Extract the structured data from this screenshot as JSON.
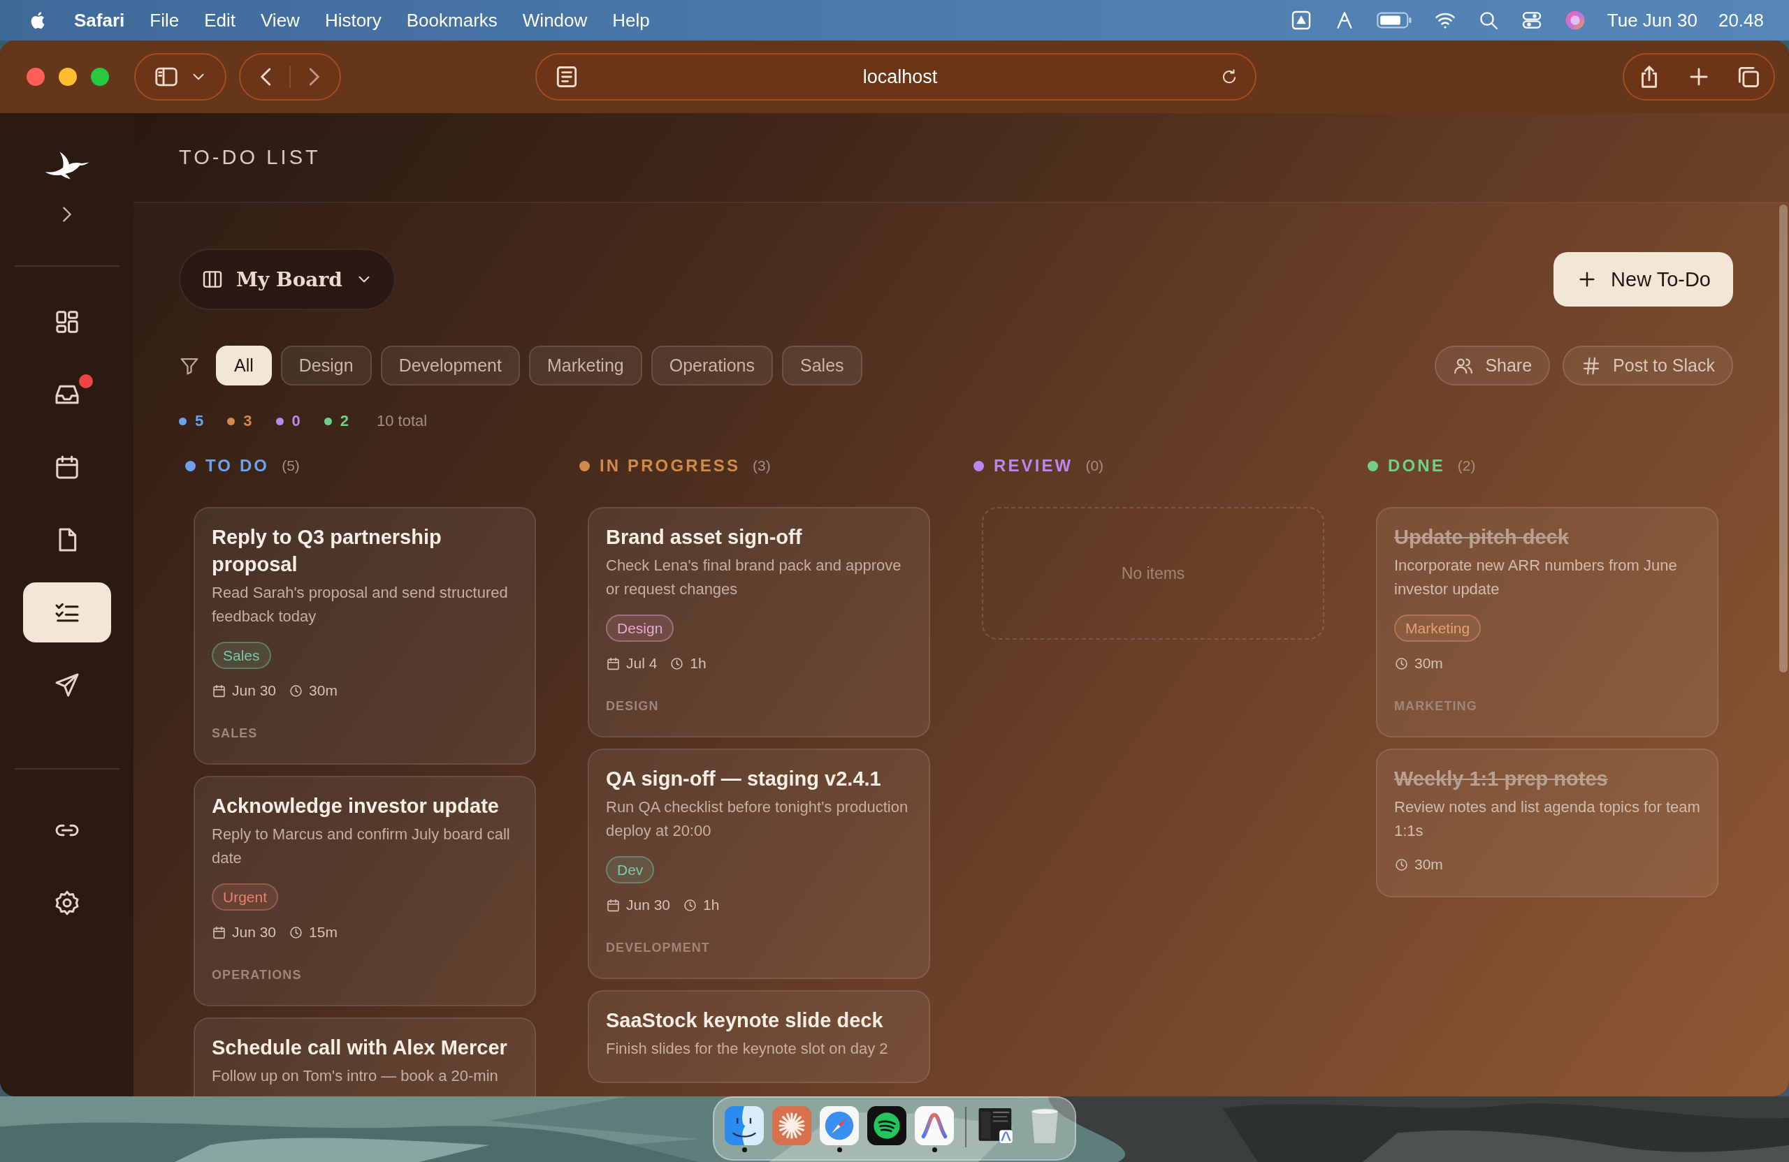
{
  "menu_bar": {
    "app": "Safari",
    "menus": [
      "File",
      "Edit",
      "View",
      "History",
      "Bookmarks",
      "Window",
      "Help"
    ],
    "date": "Tue Jun 30",
    "time": "20.48"
  },
  "browser": {
    "address": "localhost"
  },
  "sidebar": {
    "items": [
      {
        "kind": "grid",
        "selected": false,
        "badge": false
      },
      {
        "kind": "inbox",
        "selected": false,
        "badge": true
      },
      {
        "kind": "calendar",
        "selected": false,
        "badge": false
      },
      {
        "kind": "document",
        "selected": false,
        "badge": false
      },
      {
        "kind": "checklist",
        "selected": true,
        "badge": false
      },
      {
        "kind": "send",
        "selected": false,
        "badge": false
      }
    ],
    "footer_items": [
      {
        "kind": "link",
        "selected": false,
        "badge": false
      },
      {
        "kind": "settings",
        "selected": false,
        "badge": false
      }
    ]
  },
  "page": {
    "title": "TO-DO LIST",
    "board": "My Board",
    "new_button": "New To-Do",
    "filters": [
      {
        "label": "All",
        "selected": true
      },
      {
        "label": "Design",
        "selected": false
      },
      {
        "label": "Development",
        "selected": false
      },
      {
        "label": "Marketing",
        "selected": false
      },
      {
        "label": "Operations",
        "selected": false
      },
      {
        "label": "Sales",
        "selected": false
      }
    ],
    "actions": [
      {
        "kind": "share",
        "label": "Share"
      },
      {
        "kind": "slack",
        "label": "Post to Slack"
      }
    ],
    "counts": [
      {
        "value": "5",
        "color": "#6ea0f0"
      },
      {
        "value": "3",
        "color": "#d08a4a"
      },
      {
        "value": "0",
        "color": "#b888f0"
      },
      {
        "value": "2",
        "color": "#6fd08a"
      }
    ],
    "total": "10 total",
    "columns": [
      {
        "title": "TO DO",
        "count": "(5)",
        "color": "#6ea0f0",
        "cards": [
          {
            "title": "Reply to Q3 partnership proposal",
            "description": "Read Sarah's proposal and send structured feedback today",
            "tag": {
              "label": "Sales",
              "color": "#7cc9a4"
            },
            "date": "Jun 30",
            "duration": "30m",
            "category": "SALES",
            "done": false
          },
          {
            "title": "Acknowledge investor update",
            "description": "Reply to Marcus and confirm July board call date",
            "tag": {
              "label": "Urgent",
              "color": "#e8826e"
            },
            "date": "Jun 30",
            "duration": "15m",
            "category": "OPERATIONS",
            "done": false
          },
          {
            "title": "Schedule call with Alex Mercer",
            "description": "Follow up on Tom's intro — book a 20-min",
            "done": false
          }
        ]
      },
      {
        "title": "IN PROGRESS",
        "count": "(3)",
        "color": "#d08a4a",
        "cards": [
          {
            "title": "Brand asset sign-off",
            "description": "Check Lena's final brand pack and approve or request changes",
            "tag": {
              "label": "Design",
              "color": "#e6a8d4"
            },
            "date": "Jul 4",
            "duration": "1h",
            "category": "DESIGN",
            "done": false
          },
          {
            "title": "QA sign-off — staging v2.4.1",
            "description": "Run QA checklist before tonight's production deploy at 20:00",
            "tag": {
              "label": "Dev",
              "color": "#7cc9b0"
            },
            "date": "Jun 30",
            "duration": "1h",
            "category": "DEVELOPMENT",
            "done": false
          },
          {
            "title": "SaaStock keynote slide deck",
            "description": "Finish slides for the keynote slot on day 2",
            "done": false
          }
        ]
      },
      {
        "title": "REVIEW",
        "count": "(0)",
        "color": "#b888f0",
        "empty_text": "No items"
      },
      {
        "title": "DONE",
        "count": "(2)",
        "color": "#6fd08a",
        "cards": [
          {
            "title": "Update pitch deck",
            "description": "Incorporate new ARR numbers from June investor update",
            "tag": {
              "label": "Marketing",
              "color": "#e8a070"
            },
            "duration": "30m",
            "category": "MARKETING",
            "done": true
          },
          {
            "title": "Weekly 1:1 prep notes",
            "description": "Review notes and list agenda topics for team 1:1s",
            "duration": "30m",
            "done": true
          }
        ]
      }
    ]
  },
  "dock": {
    "apps": [
      {
        "kind": "face",
        "running": true
      },
      {
        "kind": "starburst",
        "running": false
      },
      {
        "kind": "compass",
        "running": true
      },
      {
        "kind": "waves",
        "running": false
      },
      {
        "kind": "arch",
        "running": true
      }
    ]
  }
}
